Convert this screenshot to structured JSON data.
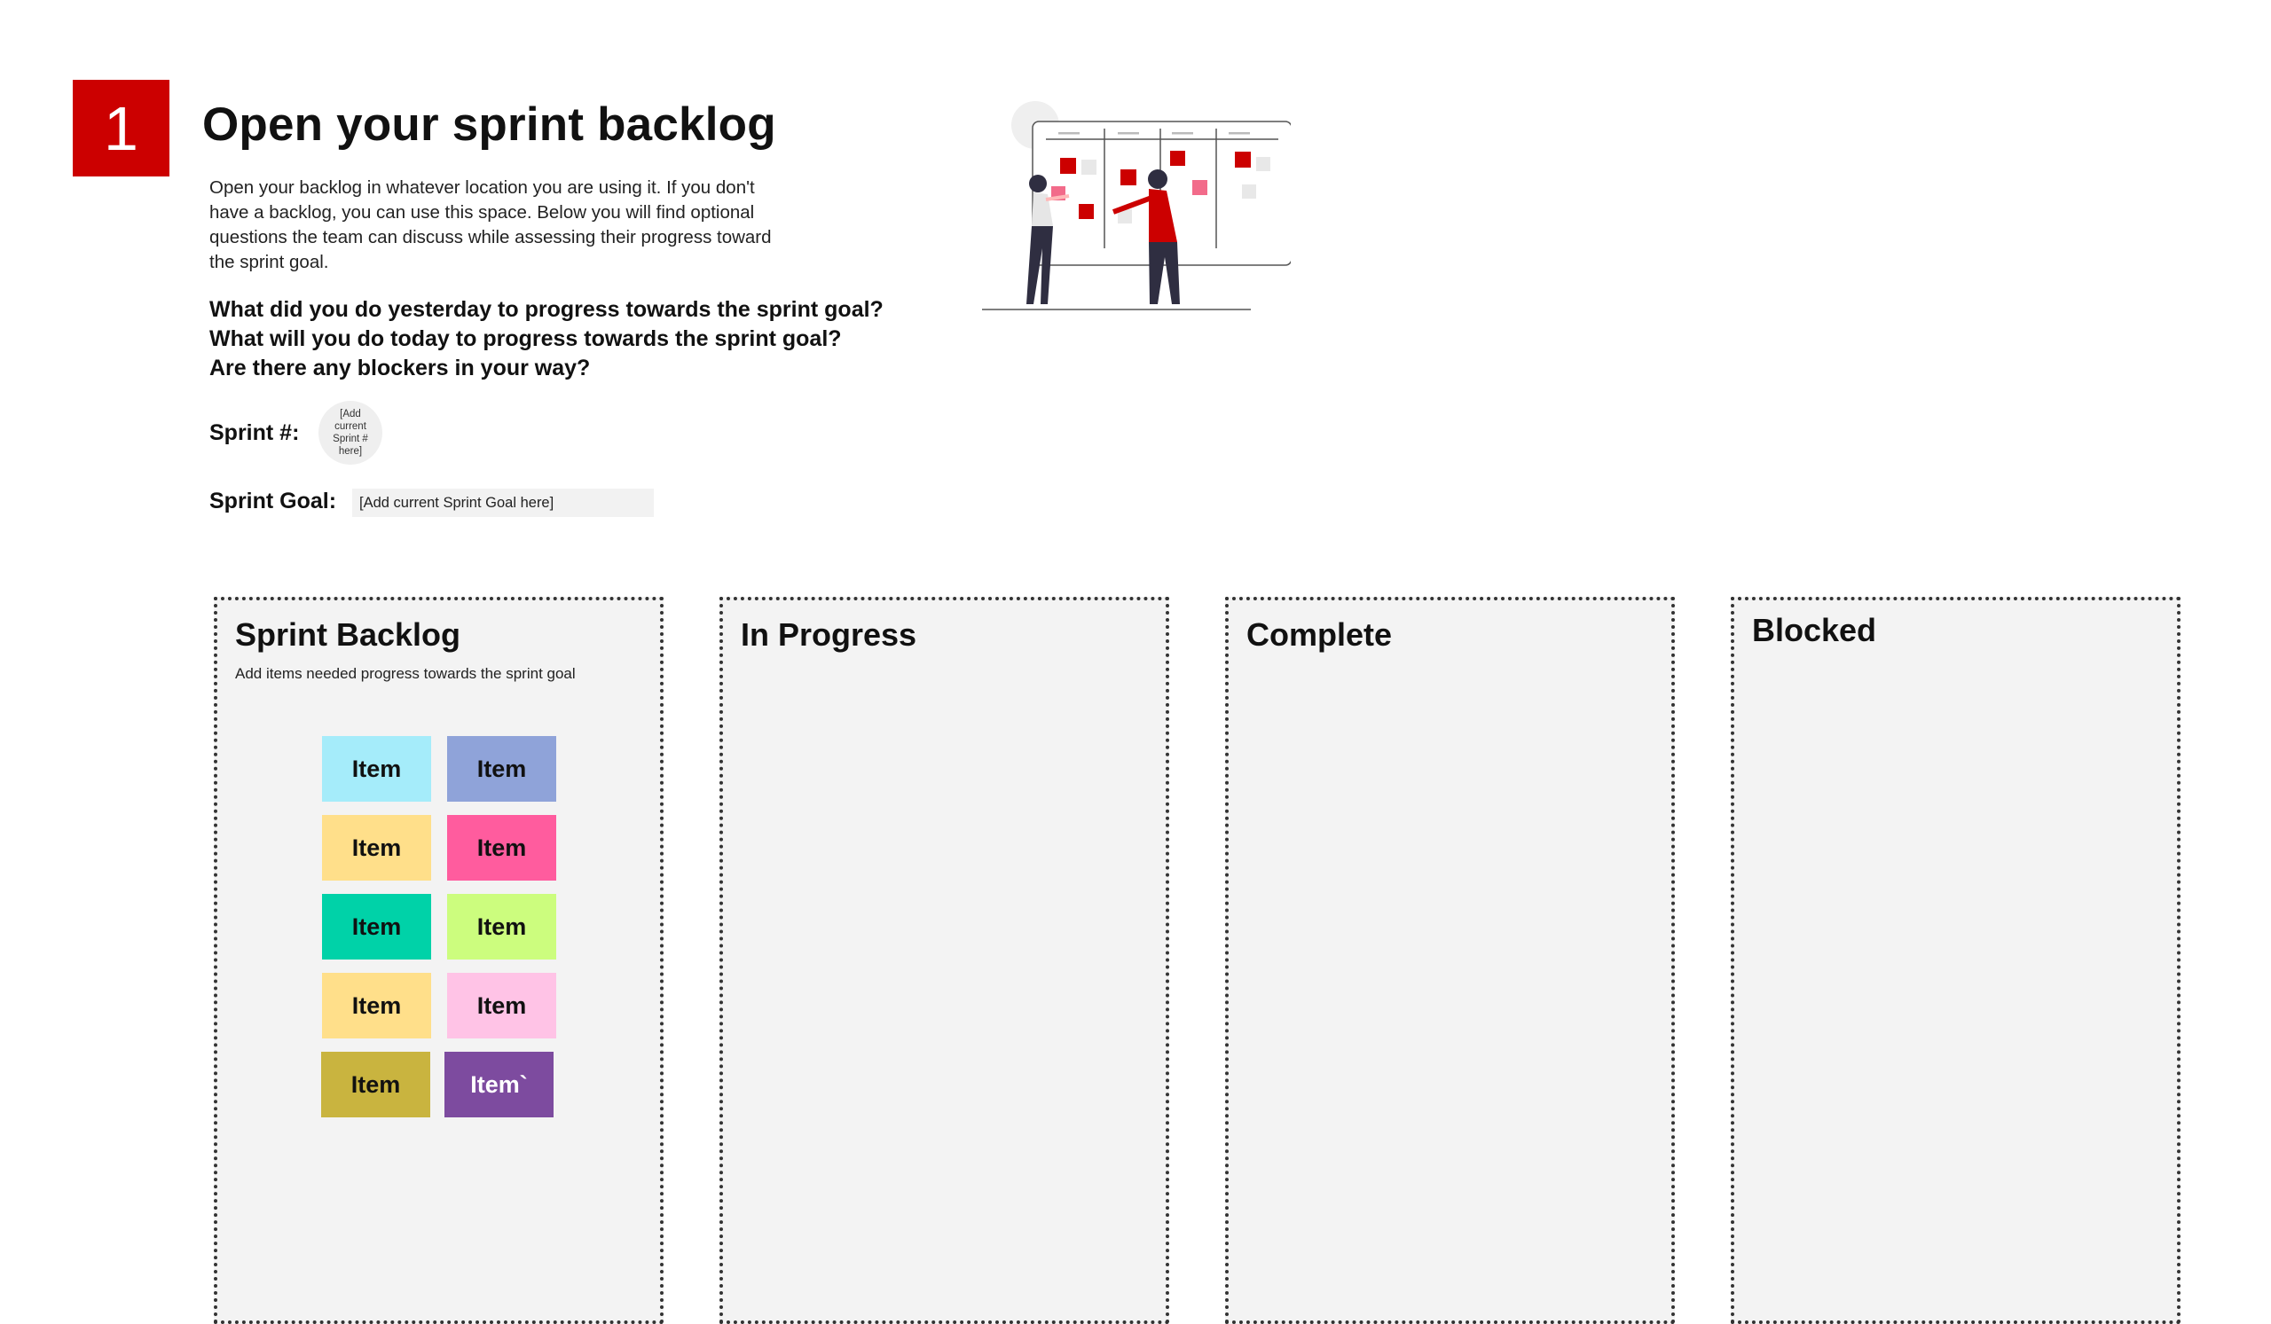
{
  "header": {
    "step_number": "1",
    "title": "Open your sprint backlog",
    "intro": "Open your backlog in whatever location you are using it. If you don't have a backlog, you can use this space. Below you will find optional questions the team can discuss while assessing their progress toward the sprint goal.",
    "questions": [
      "What did you do yesterday to progress towards the sprint goal?",
      "What will you do today to progress towards the sprint goal?",
      "Are there any blockers in your way?"
    ]
  },
  "sprint": {
    "number_label": "Sprint #:",
    "number_placeholder": "[Add current Sprint # here]",
    "goal_label": "Sprint Goal:",
    "goal_placeholder": "[Add current Sprint Goal here]"
  },
  "colors": {
    "accent": "#cc0000",
    "column_bg": "#f3f3f3"
  },
  "columns": [
    {
      "title": "Sprint Backlog",
      "subtitle": "Add items needed progress towards the sprint goal"
    },
    {
      "title": "In Progress",
      "subtitle": ""
    },
    {
      "title": "Complete",
      "subtitle": ""
    },
    {
      "title": "Blocked",
      "subtitle": ""
    }
  ],
  "stickies": [
    {
      "label": "Item",
      "color": "#a5ecfa"
    },
    {
      "label": "Item",
      "color": "#8fa3d9"
    },
    {
      "label": "Item",
      "color": "#ffdf8a"
    },
    {
      "label": "Item",
      "color": "#ff5c9e"
    },
    {
      "label": "Item",
      "color": "#00d2a8"
    },
    {
      "label": "Item",
      "color": "#ccfd7e"
    },
    {
      "label": "Item",
      "color": "#ffdf8a"
    },
    {
      "label": "Item",
      "color": "#ffc3e6"
    },
    {
      "label": "Item",
      "color": "#c9b43f"
    },
    {
      "label": "Item`",
      "color": "#7d4b9f",
      "text_color": "#ffffff"
    }
  ]
}
